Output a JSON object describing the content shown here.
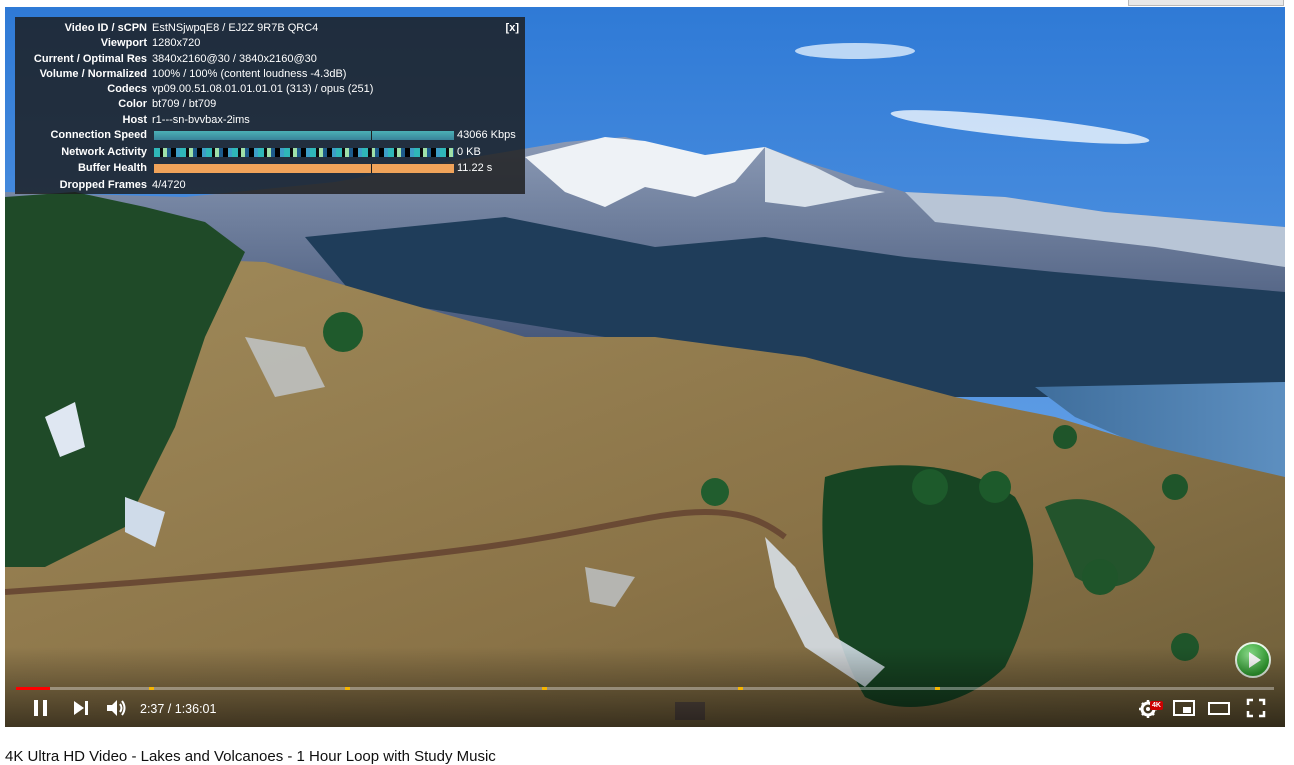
{
  "stats": {
    "close_label": "[x]",
    "rows": [
      {
        "label": "Video ID / sCPN",
        "value": "EstNSjwpqE8 / EJ2Z 9R7B QRC4"
      },
      {
        "label": "Viewport",
        "value": "1280x720"
      },
      {
        "label": "Current / Optimal Res",
        "value": "3840x2160@30 / 3840x2160@30"
      },
      {
        "label": "Volume / Normalized",
        "value": "100% / 100% (content loudness -4.3dB)"
      },
      {
        "label": "Codecs",
        "value": "vp09.00.51.08.01.01.01.01 (313) / opus (251)"
      },
      {
        "label": "Color",
        "value": "bt709 / bt709"
      },
      {
        "label": "Host",
        "value": "r1---sn-bvvbax-2ims"
      }
    ],
    "connection_speed": {
      "label": "Connection Speed",
      "value": "43066 Kbps",
      "color": "#4bb0b6"
    },
    "network_activity": {
      "label": "Network Activity",
      "value": "0 KB",
      "color": "#2fb7b8"
    },
    "buffer_health": {
      "label": "Buffer Health",
      "value": "11.22 s",
      "color": "#f0a35a"
    },
    "dropped_frames": {
      "label": "Dropped Frames",
      "value": "4/4720"
    }
  },
  "controls": {
    "play_state": "pause-icon",
    "time": "2:37 / 1:36:01",
    "played_fraction": 0.027,
    "quality_badge": "4K",
    "accent": "#ff0000",
    "chapter_color": "#f5b400"
  },
  "video_title": "4K Ultra HD Video - Lakes and Volcanoes - 1 Hour Loop with Study Music"
}
